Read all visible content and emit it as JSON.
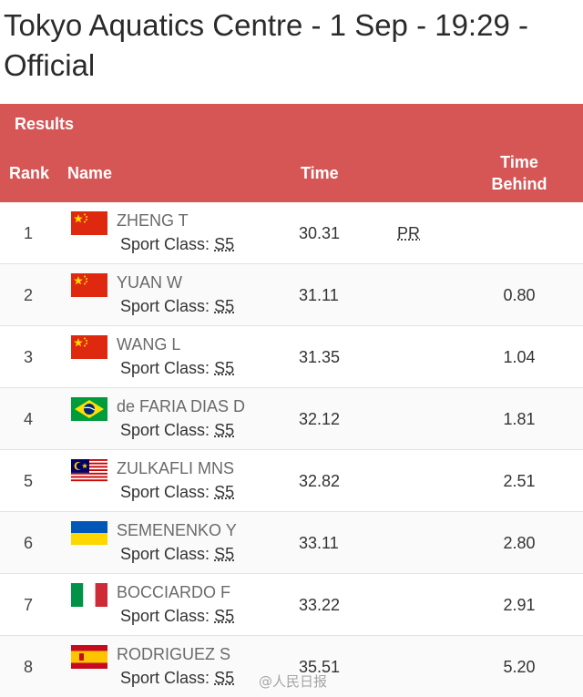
{
  "page": {
    "title": "Tokyo Aquatics Centre - 1 Sep - 19:29 - Official"
  },
  "table": {
    "section_label": "Results",
    "columns": {
      "rank": "Rank",
      "name": "Name",
      "time": "Time",
      "time_behind": "Time Behind"
    },
    "rows": [
      {
        "rank": "1",
        "name": "ZHENG T",
        "sport_class_label": "Sport Class:",
        "sport_class": "S5",
        "time": "30.31",
        "record": "PR",
        "time_behind": "",
        "flag": "china-flag-icon"
      },
      {
        "rank": "2",
        "name": "YUAN W",
        "sport_class_label": "Sport Class:",
        "sport_class": "S5",
        "time": "31.11",
        "record": "",
        "time_behind": "0.80",
        "flag": "china-flag-icon"
      },
      {
        "rank": "3",
        "name": "WANG L",
        "sport_class_label": "Sport Class:",
        "sport_class": "S5",
        "time": "31.35",
        "record": "",
        "time_behind": "1.04",
        "flag": "china-flag-icon"
      },
      {
        "rank": "4",
        "name": "de FARIA DIAS D",
        "sport_class_label": "Sport Class:",
        "sport_class": "S5",
        "time": "32.12",
        "record": "",
        "time_behind": "1.81",
        "flag": "brazil-flag-icon"
      },
      {
        "rank": "5",
        "name": "ZULKAFLI MNS",
        "sport_class_label": "Sport Class:",
        "sport_class": "S5",
        "time": "32.82",
        "record": "",
        "time_behind": "2.51",
        "flag": "malaysia-flag-icon"
      },
      {
        "rank": "6",
        "name": "SEMENENKO Y",
        "sport_class_label": "Sport Class:",
        "sport_class": "S5",
        "time": "33.11",
        "record": "",
        "time_behind": "2.80",
        "flag": "ukraine-flag-icon"
      },
      {
        "rank": "7",
        "name": "BOCCIARDO F",
        "sport_class_label": "Sport Class:",
        "sport_class": "S5",
        "time": "33.22",
        "record": "",
        "time_behind": "2.91",
        "flag": "italy-flag-icon"
      },
      {
        "rank": "8",
        "name": "RODRIGUEZ S",
        "sport_class_label": "Sport Class:",
        "sport_class": "S5",
        "time": "35.51",
        "record": "",
        "time_behind": "5.20",
        "flag": "spain-flag-icon"
      }
    ]
  },
  "colors": {
    "header_bg": "#d65656",
    "header_text": "#ffffff"
  },
  "watermark": "@人民日报"
}
